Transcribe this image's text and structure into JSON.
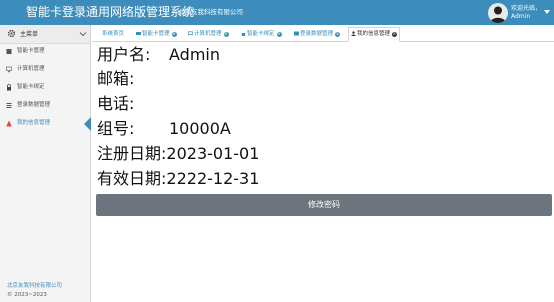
{
  "header": {
    "title": "智能卡登录通用网络版管理系统",
    "company": "北京友我科技有限公司",
    "user": {
      "welcome": "欢迎光临，",
      "name": "Admin"
    }
  },
  "sidebar": {
    "title": "主菜单",
    "items": [
      {
        "label": "智能卡管理"
      },
      {
        "label": "计算机管理"
      },
      {
        "label": "智能卡绑定"
      },
      {
        "label": "登录数据管理"
      },
      {
        "label": "我的信息管理"
      }
    ],
    "footer_company": "北京友我科技有限公司",
    "footer_copyright": "© 2023~2023"
  },
  "tabs": [
    {
      "label": "系统首页"
    },
    {
      "label": "智能卡管理"
    },
    {
      "label": "计算机管理"
    },
    {
      "label": "智能卡绑定"
    },
    {
      "label": "登录数据管理"
    },
    {
      "label": "我的信息管理"
    }
  ],
  "profile": {
    "username_label": "用户名:",
    "username": "Admin",
    "email_label": "邮箱:",
    "email": "",
    "phone_label": "电话:",
    "phone": "",
    "group_label": "组号:",
    "group": "10000A",
    "registered_label": "注册日期:",
    "registered": "2023-01-01",
    "expires_label": "有效日期:",
    "expires": "2222-12-31"
  },
  "actions": {
    "change_password": "修改密码"
  },
  "colors": {
    "primary": "#3c8dbc",
    "button": "#6c757d",
    "sidebar_bg": "#f4f4f4",
    "warning": "#dd4b39"
  }
}
